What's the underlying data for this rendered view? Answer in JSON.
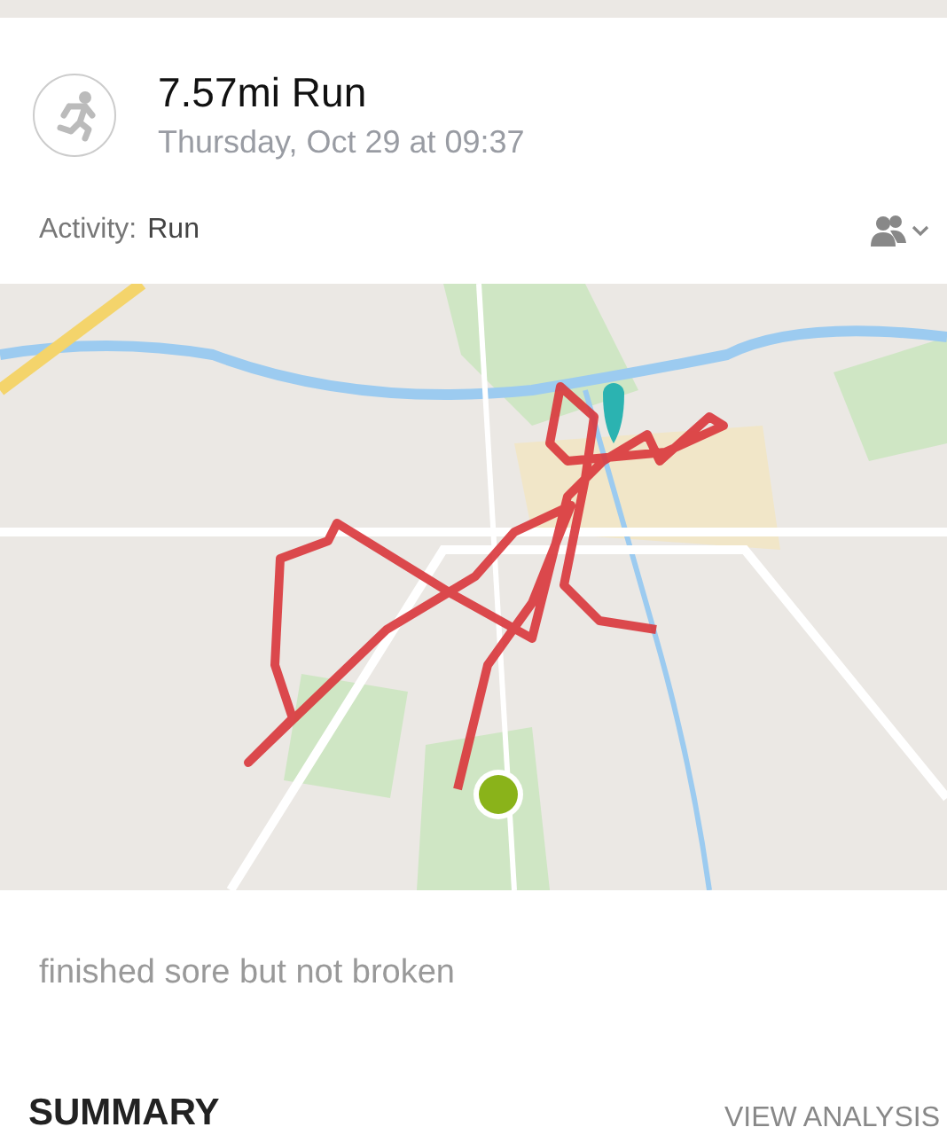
{
  "activity": {
    "title": "7.57mi Run",
    "datetime": "Thursday, Oct 29 at 09:37",
    "label": "Activity:",
    "type": "Run"
  },
  "note": "finished sore but not broken",
  "summary": {
    "title": "SUMMARY",
    "link": "VIEW ANALYSIS"
  }
}
